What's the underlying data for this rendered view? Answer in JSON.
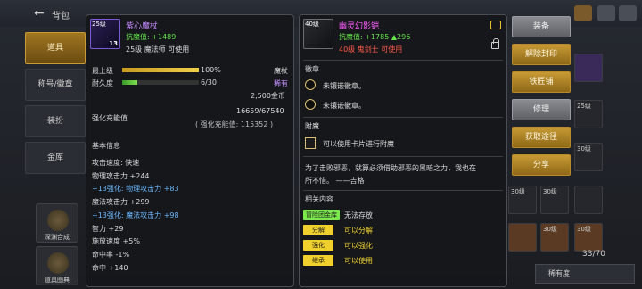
{
  "bag": {
    "title": "背包",
    "tabs": [
      "道具",
      "称号/徽章",
      "装扮",
      "金库"
    ],
    "side_buttons": [
      "深渊合成",
      "道具图典"
    ],
    "count": "33/70",
    "sort_label": "稀有度",
    "slot_counts": [
      "30级",
      "25级",
      "30级",
      "30级",
      "30级",
      "30级"
    ]
  },
  "left_item": {
    "level_tag": "25级",
    "enhance": "13",
    "name": "紫心魔杖",
    "stat": "抗魔值: +1489",
    "requirement": "25级 魔法师 可使用",
    "max_level_label": "最上级",
    "max_level_value": "100%",
    "durability_label": "耐久度",
    "durability_value": "6/30",
    "durability_fraction": 0.2,
    "type": "魔杖",
    "rarity": "稀有",
    "price": "2,500金币",
    "enhance_label": "强化充能值",
    "enhance_value": "16659/67540",
    "enhance_total": "( 强化充能值: 115352 )",
    "basic_info_title": "基本信息",
    "attributes": [
      {
        "text": "攻击速度: 快速",
        "color": "normal"
      },
      {
        "text": "物理攻击力 +244",
        "color": "normal"
      },
      {
        "text": "+13强化: 物理攻击力 +83",
        "color": "blue"
      },
      {
        "text": "魔法攻击力 +299",
        "color": "normal"
      },
      {
        "text": "+13强化: 魔法攻击力 +98",
        "color": "blue"
      },
      {
        "text": "智力 +29",
        "color": "normal"
      },
      {
        "text": "施放速度 +5%",
        "color": "normal"
      },
      {
        "text": "命中率 -1%",
        "color": "normal"
      },
      {
        "text": "命中 +140",
        "color": "normal"
      }
    ]
  },
  "right_item": {
    "level_tag": "40级",
    "name": "幽灵幻影铠",
    "stat_prefix": "抗魔值: +1785",
    "stat_up": "▲296",
    "requirement": "40级 鬼剑士 可使用",
    "emblem_title": "徽章",
    "emblem_slots": [
      "未镶嵌徽章。",
      "未镶嵌徽章。"
    ],
    "enchant_title": "附魔",
    "enchant_text": "可以使用卡片进行附魔",
    "flavor_line1": "为了击败邪恶，就算必须借助邪恶的黑暗之力，我也在",
    "flavor_line2": "所不惜。  ——吉格",
    "related_title": "相关内容",
    "related": [
      {
        "tag": "冒险团金库",
        "text": "无法存放",
        "tag_color": "green",
        "text_color": "normal"
      },
      {
        "tag": "分解",
        "text": "可以分解",
        "tag_color": "yellow",
        "text_color": "yellow"
      },
      {
        "tag": "强化",
        "text": "可以强化",
        "tag_color": "yellow",
        "text_color": "yellow"
      },
      {
        "tag": "继承",
        "text": "可以使用",
        "tag_color": "yellow",
        "text_color": "yellow"
      }
    ]
  },
  "actions": [
    {
      "label": "装备",
      "style": "gray"
    },
    {
      "label": "解除封印",
      "style": "gold"
    },
    {
      "label": "铁匠铺",
      "style": "gold"
    },
    {
      "label": "修理",
      "style": "gray"
    },
    {
      "label": "获取途径",
      "style": "gold"
    },
    {
      "label": "分享",
      "style": "gold"
    }
  ],
  "colors": {
    "accent_gold": "#c79a34",
    "rarity_purple": "#c58cff",
    "stat_green": "#64e64a",
    "enhance_blue": "#6ab8ff",
    "req_red": "#ff5a4a"
  }
}
